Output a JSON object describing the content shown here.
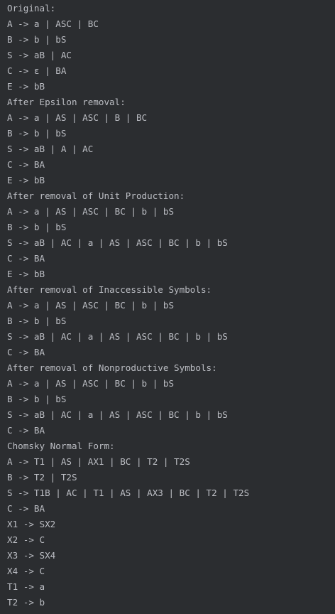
{
  "console": {
    "text_color": "#bcbec4",
    "background_color": "#2b2d30",
    "lines": [
      "Original:",
      "A -> a | ASC | BC",
      "B -> b | bS",
      "S -> aB | AC",
      "C -> ε | BA",
      "E -> bB",
      "After Epsilon removal:",
      "A -> a | AS | ASC | B | BC",
      "B -> b | bS",
      "S -> aB | A | AC",
      "C -> BA",
      "E -> bB",
      "After removal of Unit Production:",
      "A -> a | AS | ASC | BC | b | bS",
      "B -> b | bS",
      "S -> aB | AC | a | AS | ASC | BC | b | bS",
      "C -> BA",
      "E -> bB",
      "After removal of Inaccessible Symbols:",
      "A -> a | AS | ASC | BC | b | bS",
      "B -> b | bS",
      "S -> aB | AC | a | AS | ASC | BC | b | bS",
      "C -> BA",
      "After removal of Nonproductive Symbols:",
      "A -> a | AS | ASC | BC | b | bS",
      "B -> b | bS",
      "S -> aB | AC | a | AS | ASC | BC | b | bS",
      "C -> BA",
      "Chomsky Normal Form:",
      "A -> T1 | AS | AX1 | BC | T2 | T2S",
      "B -> T2 | T2S",
      "S -> T1B | AC | T1 | AS | AX3 | BC | T2 | T2S",
      "C -> BA",
      "X1 -> SX2",
      "X2 -> C",
      "X3 -> SX4",
      "X4 -> C",
      "T1 -> a",
      "T2 -> b"
    ]
  }
}
